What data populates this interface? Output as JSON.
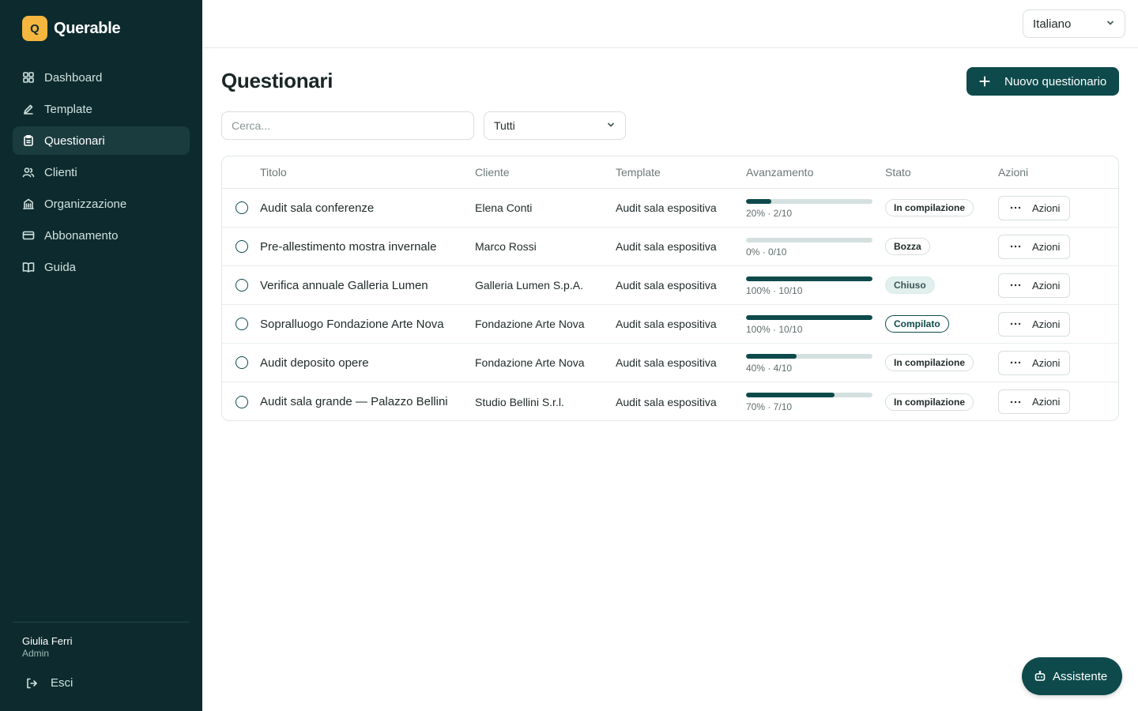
{
  "brand": {
    "logo_letter": "Q",
    "name": "Querable",
    "logo_color": "#f4b63f"
  },
  "sidebar": {
    "items": [
      {
        "label": "Dashboard",
        "icon": "grid-icon",
        "active": false
      },
      {
        "label": "Template",
        "icon": "pencil-icon",
        "active": false
      },
      {
        "label": "Questionari",
        "icon": "clipboard-icon",
        "active": true
      },
      {
        "label": "Clienti",
        "icon": "users-icon",
        "active": false
      },
      {
        "label": "Organizzazione",
        "icon": "building-icon",
        "active": false
      },
      {
        "label": "Abbonamento",
        "icon": "credit-card-icon",
        "active": false
      },
      {
        "label": "Guida",
        "icon": "book-icon",
        "active": false
      }
    ],
    "user": {
      "name": "Giulia Ferri",
      "role": "Admin"
    },
    "logout_label": "Esci"
  },
  "topbar": {
    "language": "Italiano"
  },
  "main": {
    "title": "Questionari",
    "new_button_label": "Nuovo questionario",
    "search_placeholder": "Cerca...",
    "filter_value": "Tutti"
  },
  "table": {
    "headers": {
      "title": "Titolo",
      "client": "Cliente",
      "template": "Template",
      "progress": "Avanzamento",
      "status": "Stato",
      "actions": "Azioni"
    },
    "rows": [
      {
        "title": "Audit sala conferenze",
        "client": "Elena Conti",
        "template": "Audit sala espositiva",
        "progress_pct": 20,
        "progress_text": "20% · 2/10",
        "status": "In compilazione",
        "status_kind": "progress",
        "action_label": "Azioni"
      },
      {
        "title": "Pre-allestimento mostra invernale",
        "client": "Marco Rossi",
        "template": "Audit sala espositiva",
        "progress_pct": 0,
        "progress_text": "0% · 0/10",
        "status": "Bozza",
        "status_kind": "draft",
        "action_label": "Azioni"
      },
      {
        "title": "Verifica annuale Galleria Lumen",
        "client": "Galleria Lumen S.p.A.",
        "template": "Audit sala espositiva",
        "progress_pct": 100,
        "progress_text": "100% · 10/10",
        "status": "Chiuso",
        "status_kind": "closed",
        "action_label": "Azioni"
      },
      {
        "title": "Sopralluogo Fondazione Arte Nova",
        "client": "Fondazione Arte Nova",
        "template": "Audit sala espositiva",
        "progress_pct": 100,
        "progress_text": "100% · 10/10",
        "status": "Compilato",
        "status_kind": "done",
        "action_label": "Azioni"
      },
      {
        "title": "Audit deposito opere",
        "client": "Fondazione Arte Nova",
        "template": "Audit sala espositiva",
        "progress_pct": 40,
        "progress_text": "40% · 4/10",
        "status": "In compilazione",
        "status_kind": "progress",
        "action_label": "Azioni"
      },
      {
        "title": "Audit sala grande — Palazzo Bellini",
        "client": "Studio Bellini S.r.l.",
        "template": "Audit sala espositiva",
        "progress_pct": 70,
        "progress_text": "70% · 7/10",
        "status": "In compilazione",
        "status_kind": "progress",
        "action_label": "Azioni"
      }
    ]
  },
  "assistant": {
    "label": "Assistente"
  },
  "colors": {
    "sidebar_bg": "#0d2b2e",
    "accent": "#0e4a4b",
    "progress_track": "#d4e0df"
  }
}
